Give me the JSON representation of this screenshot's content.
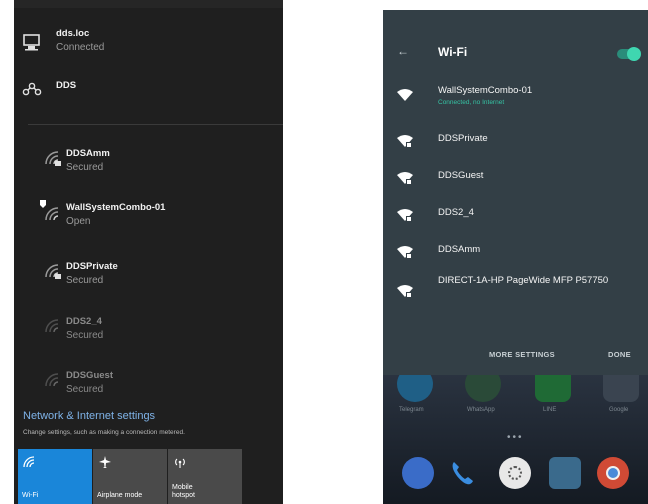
{
  "windows_flyout": {
    "connections": [
      {
        "name": "dds.loc",
        "status": "Connected",
        "icon": "ethernet-icon"
      },
      {
        "name": "DDS",
        "status": "",
        "icon": "dialup-icon"
      }
    ],
    "networks": [
      {
        "name": "DDSAmm",
        "status": "Secured",
        "icon": "wifi-secured-icon"
      },
      {
        "name": "WallSystemCombo-01",
        "status": "Open",
        "icon": "wifi-open-icon"
      },
      {
        "name": "DDSPrivate",
        "status": "Secured",
        "icon": "wifi-secured-icon"
      },
      {
        "name": "DDS2_4",
        "status": "Secured",
        "icon": "wifi-secured-icon"
      },
      {
        "name": "DDSGuest",
        "status": "Secured",
        "icon": "wifi-secured-icon"
      }
    ],
    "settings_link": "Network & Internet settings",
    "settings_subtext": "Change settings, such as making a connection metered.",
    "tiles": [
      {
        "label": "Wi-Fi",
        "icon": "wifi-icon",
        "active": true
      },
      {
        "label": "Airplane mode",
        "icon": "airplane-icon",
        "active": false
      },
      {
        "label": "Mobile hotspot",
        "icon": "hotspot-icon",
        "active": false
      }
    ],
    "colors": {
      "panel": "#1f1f1f",
      "accent": "#1a86d9",
      "tile": "#4a4a4a"
    }
  },
  "android_wifi": {
    "back_icon": "back-arrow-icon",
    "title": "Wi-Fi",
    "toggle_on": true,
    "networks": [
      {
        "name": "WallSystemCombo-01",
        "subtitle": "Connected, no Internet",
        "icon": "wifi-full-icon"
      },
      {
        "name": "DDSPrivate",
        "subtitle": "",
        "icon": "wifi-lock-icon"
      },
      {
        "name": "DDSGuest",
        "subtitle": "",
        "icon": "wifi-lock-icon"
      },
      {
        "name": "DDS2_4",
        "subtitle": "",
        "icon": "wifi-lock-icon"
      },
      {
        "name": "DDSAmm",
        "subtitle": "",
        "icon": "wifi-lock-icon"
      },
      {
        "name": "DIRECT-1A-HP PageWide MFP P57750",
        "subtitle": "",
        "icon": "wifi-lock-icon"
      }
    ],
    "buttons": {
      "more_settings": "MORE SETTINGS",
      "done": "DONE"
    },
    "home_apps": [
      "Telegram",
      "WhatsApp",
      "LINE",
      "Google"
    ],
    "dock_apps": [
      "messages-icon",
      "phone-icon",
      "app-drawer-icon",
      "camera-icon",
      "chrome-icon"
    ],
    "colors": {
      "dialog": "#333f46",
      "accent": "#35c2a3"
    }
  }
}
